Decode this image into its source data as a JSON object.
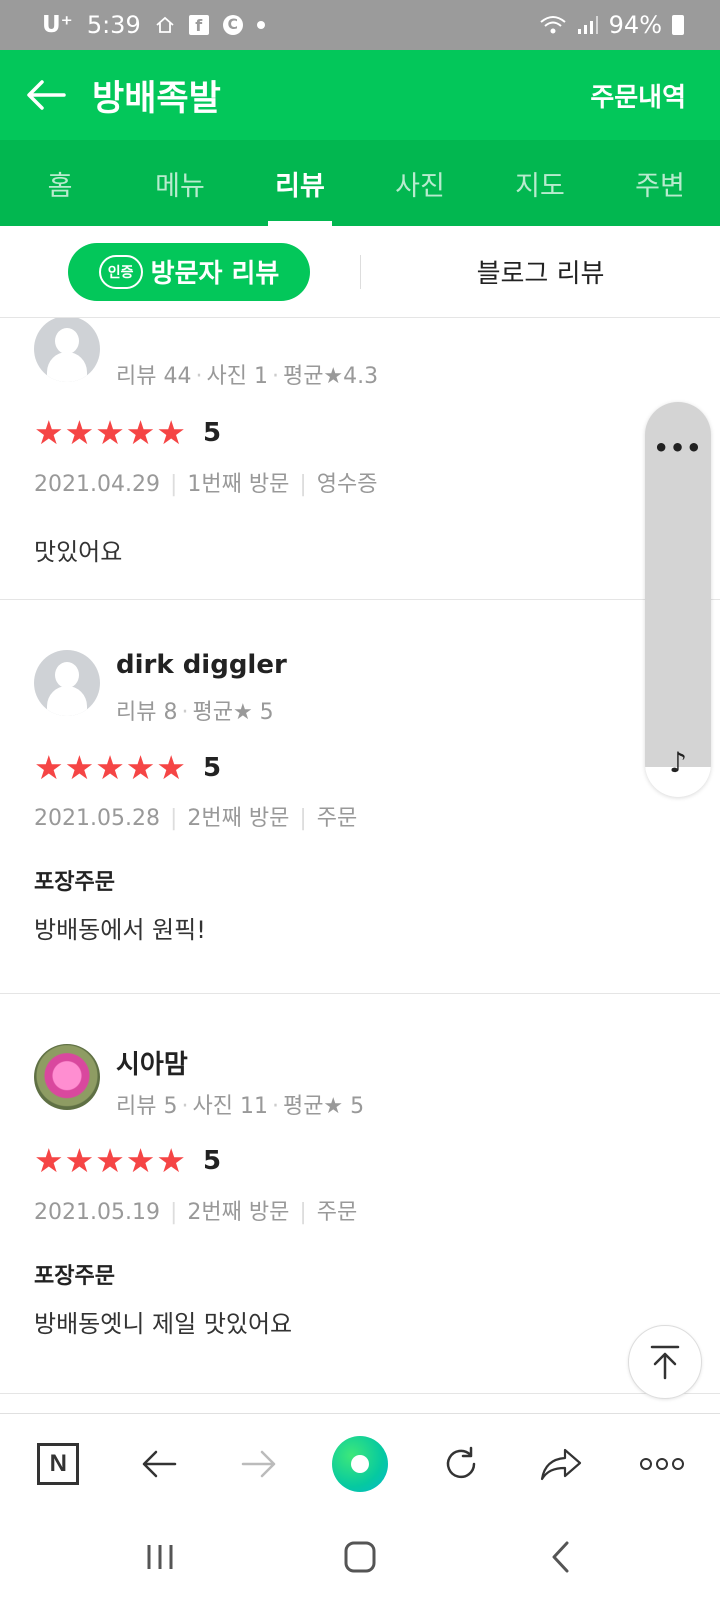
{
  "status_bar": {
    "carrier": "U⁺",
    "time": "5:39",
    "battery": "94%"
  },
  "header": {
    "title": "방배족발",
    "order_history": "주문내역"
  },
  "tabs": [
    {
      "label": "홈"
    },
    {
      "label": "메뉴"
    },
    {
      "label": "리뷰"
    },
    {
      "label": "사진"
    },
    {
      "label": "지도"
    },
    {
      "label": "주변"
    }
  ],
  "active_tab": "리뷰",
  "subtabs": {
    "badge": "인증",
    "visitor": "방문자 리뷰",
    "blog": "블로그 리뷰"
  },
  "reviews": [
    {
      "name": "",
      "meta": [
        "리뷰 44",
        "사진 1",
        "평균★4.3"
      ],
      "rating": 5,
      "visit": [
        "2021.04.29",
        "1번째 방문",
        "영수증"
      ],
      "tag": "",
      "text": "맛있어요"
    },
    {
      "name": "dirk diggler",
      "meta": [
        "리뷰 8",
        "평균★ 5"
      ],
      "rating": 5,
      "visit": [
        "2021.05.28",
        "2번째 방문",
        "주문"
      ],
      "tag": "포장주문",
      "text": "방배동에서 원픽!"
    },
    {
      "name": "시아맘",
      "meta": [
        "리뷰 5",
        "사진 11",
        "평균★ 5"
      ],
      "rating": 5,
      "visit": [
        "2021.05.19",
        "2번째 방문",
        "주문"
      ],
      "tag": "포장주문",
      "text": "방배동엣니 제일 맛있어요"
    }
  ],
  "float_panel": {
    "more": "•••",
    "music": "♪"
  },
  "colors": {
    "brand_green": "#03c75a",
    "tab_green": "#02b750",
    "star_red": "#f54545"
  }
}
